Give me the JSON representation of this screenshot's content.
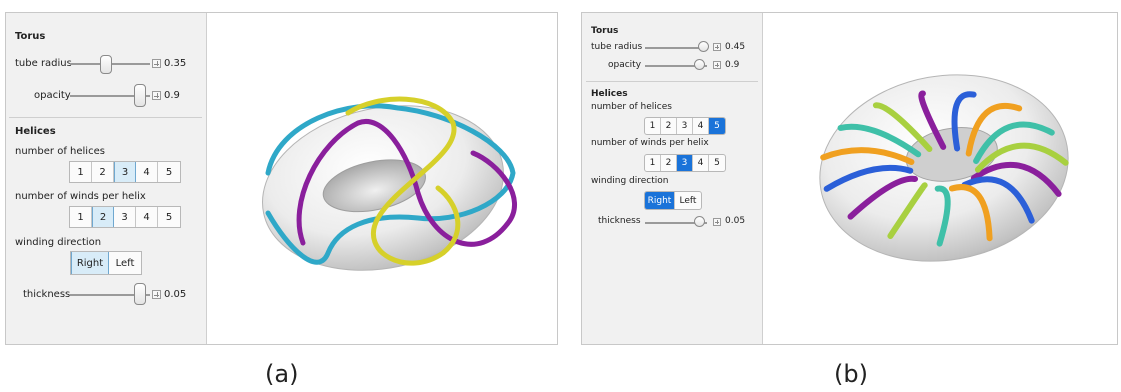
{
  "panel_a": {
    "torus_title": "Torus",
    "tube_radius_label": "tube radius",
    "tube_radius_value": "0.35",
    "tube_radius_level": 0.45,
    "opacity_label": "opacity",
    "opacity_value": "0.9",
    "opacity_level": 0.88,
    "helices_title": "Helices",
    "num_helices_label": "number of helices",
    "num_helices_options": [
      "1",
      "2",
      "3",
      "4",
      "5"
    ],
    "num_helices_selected": "3",
    "num_winds_label": "number of winds per helix",
    "num_winds_options": [
      "1",
      "2",
      "3",
      "4",
      "5"
    ],
    "num_winds_selected": "2",
    "winding_label": "winding direction",
    "winding_options": [
      "Right",
      "Left"
    ],
    "winding_selected": "Right",
    "thickness_label": "thickness",
    "thickness_value": "0.05",
    "thickness_level": 0.88,
    "helix_colors": [
      "#2fa8c8",
      "#8a1f9c",
      "#d6d02a"
    ]
  },
  "panel_b": {
    "torus_title": "Torus",
    "tube_radius_label": "tube radius",
    "tube_radius_value": "0.45",
    "tube_radius_level": 0.95,
    "opacity_label": "opacity",
    "opacity_value": "0.9",
    "opacity_level": 0.88,
    "helices_title": "Helices",
    "num_helices_label": "number of helices",
    "num_helices_options": [
      "1",
      "2",
      "3",
      "4",
      "5"
    ],
    "num_helices_selected": "5",
    "num_winds_label": "number of winds per helix",
    "num_winds_options": [
      "1",
      "2",
      "3",
      "4",
      "5"
    ],
    "num_winds_selected": "3",
    "winding_label": "winding direction",
    "winding_options": [
      "Right",
      "Left"
    ],
    "winding_selected": "Right",
    "thickness_label": "thickness",
    "thickness_value": "0.05",
    "thickness_level": 0.88,
    "helix_colors": [
      "#8a1f9c",
      "#2b5fd8",
      "#f0a020",
      "#3fc0a8",
      "#a8d040"
    ]
  },
  "captions": {
    "a": "(a)",
    "b": "(b)"
  }
}
